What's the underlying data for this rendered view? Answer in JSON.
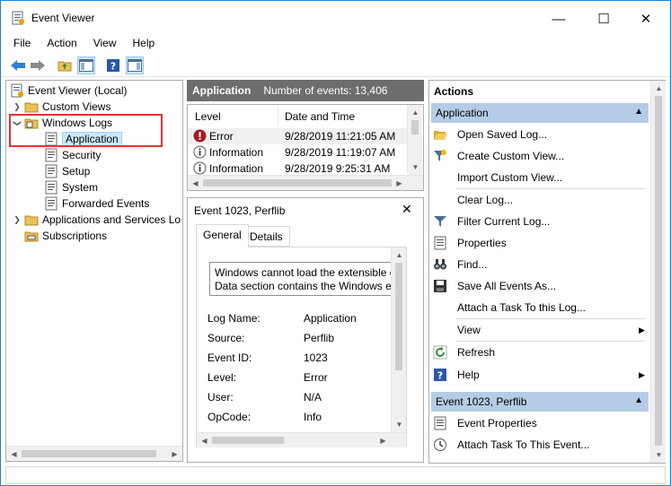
{
  "window": {
    "title": "Event Viewer",
    "controls": [
      "—",
      "☐",
      "✕"
    ]
  },
  "menu": [
    "File",
    "Action",
    "View",
    "Help"
  ],
  "tree": {
    "root": "Event Viewer (Local)",
    "items": [
      {
        "label": "Custom Views"
      },
      {
        "label": "Windows Logs"
      },
      {
        "label": "Application"
      },
      {
        "label": "Security"
      },
      {
        "label": "Setup"
      },
      {
        "label": "System"
      },
      {
        "label": "Forwarded Events"
      },
      {
        "label": "Applications and Services Lo"
      },
      {
        "label": "Subscriptions"
      }
    ]
  },
  "center": {
    "log_name": "Application",
    "event_count": "Number of events: 13,406",
    "columns": [
      "Level",
      "Date and Time"
    ],
    "rows": [
      {
        "level": "Error",
        "datetime": "9/28/2019 11:21:05 AM"
      },
      {
        "level": "Information",
        "datetime": "9/28/2019 11:19:07 AM"
      },
      {
        "level": "Information",
        "datetime": "9/28/2019 9:25:31 AM"
      }
    ]
  },
  "detail": {
    "title": "Event 1023, Perflib",
    "close": "✕",
    "tabs": [
      "General",
      "Details"
    ],
    "message_line1": "Windows cannot load the extensible co",
    "message_line2": "Data section contains the Windows erro",
    "props": [
      {
        "label": "Log Name:",
        "value": "Application"
      },
      {
        "label": "Source:",
        "value": "Perflib"
      },
      {
        "label": "Event ID:",
        "value": "1023"
      },
      {
        "label": "Level:",
        "value": "Error"
      },
      {
        "label": "User:",
        "value": "N/A"
      },
      {
        "label": "OpCode:",
        "value": "Info"
      }
    ]
  },
  "actions": {
    "title": "Actions",
    "section1": "Application",
    "items1": [
      "Open Saved Log...",
      "Create Custom View...",
      "Import Custom View...",
      "Clear Log...",
      "Filter Current Log...",
      "Properties",
      "Find...",
      "Save All Events As...",
      "Attach a Task To this Log...",
      "View",
      "Refresh",
      "Help"
    ],
    "section2": "Event 1023, Perflib",
    "items2": [
      "Event Properties",
      "Attach Task To This Event..."
    ]
  },
  "colors": {
    "header_gray": "#6d6d6d",
    "section_blue": "#b5cce6",
    "highlight_red": "#e63030",
    "selection_blue": "#cce8ff"
  }
}
